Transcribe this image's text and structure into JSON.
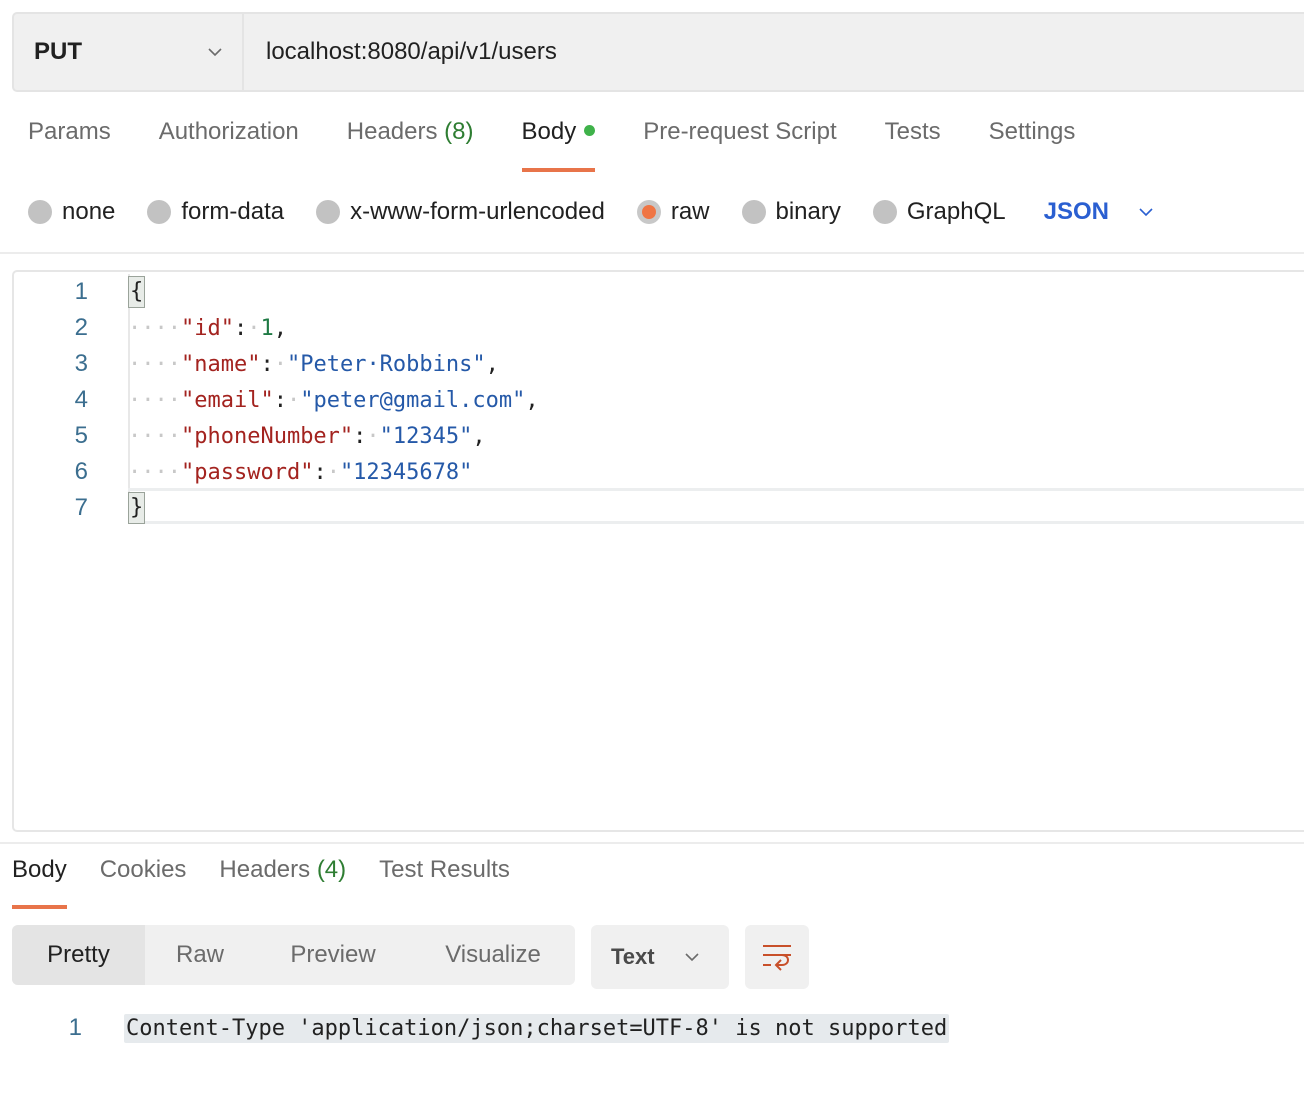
{
  "request": {
    "method": "PUT",
    "url": "localhost:8080/api/v1/users"
  },
  "request_tabs": [
    {
      "label": "Params",
      "count": null,
      "active": false
    },
    {
      "label": "Authorization",
      "count": null,
      "active": false
    },
    {
      "label": "Headers",
      "count": "(8)",
      "active": false
    },
    {
      "label": "Body",
      "count": null,
      "active": true,
      "indicator": "green-dot"
    },
    {
      "label": "Pre-request Script",
      "count": null,
      "active": false
    },
    {
      "label": "Tests",
      "count": null,
      "active": false
    },
    {
      "label": "Settings",
      "count": null,
      "active": false
    }
  ],
  "body_types": [
    {
      "label": "none",
      "checked": false
    },
    {
      "label": "form-data",
      "checked": false
    },
    {
      "label": "x-www-form-urlencoded",
      "checked": false
    },
    {
      "label": "raw",
      "checked": true
    },
    {
      "label": "binary",
      "checked": false
    },
    {
      "label": "GraphQL",
      "checked": false
    }
  ],
  "raw_language": "JSON",
  "editor": {
    "line_numbers": [
      "1",
      "2",
      "3",
      "4",
      "5",
      "6",
      "7"
    ],
    "lines": [
      {
        "open_brace": "{"
      },
      {
        "indent": "····",
        "key": "\"id\"",
        "colon": ":",
        "space": "·",
        "value": "1",
        "value_type": "number",
        "trail": ","
      },
      {
        "indent": "····",
        "key": "\"name\"",
        "colon": ":",
        "space": "·",
        "value": "\"Peter·Robbins\"",
        "value_type": "string",
        "trail": ","
      },
      {
        "indent": "····",
        "key": "\"email\"",
        "colon": ":",
        "space": "·",
        "value": "\"peter@gmail.com\"",
        "value_type": "string",
        "trail": ","
      },
      {
        "indent": "····",
        "key": "\"phoneNumber\"",
        "colon": ":",
        "space": "·",
        "value": "\"12345\"",
        "value_type": "string",
        "trail": ","
      },
      {
        "indent": "····",
        "key": "\"password\"",
        "colon": ":",
        "space": "·",
        "value": "\"12345678\"",
        "value_type": "string",
        "trail": ""
      },
      {
        "close_brace": "}"
      }
    ]
  },
  "response_tabs": [
    {
      "label": "Body",
      "count": null,
      "active": true
    },
    {
      "label": "Cookies",
      "count": null,
      "active": false
    },
    {
      "label": "Headers",
      "count": "(4)",
      "active": false
    },
    {
      "label": "Test Results",
      "count": null,
      "active": false
    }
  ],
  "response_views": [
    {
      "label": "Pretty",
      "active": true
    },
    {
      "label": "Raw",
      "active": false
    },
    {
      "label": "Preview",
      "active": false
    },
    {
      "label": "Visualize",
      "active": false
    }
  ],
  "response_format": "Text",
  "wrap_icon": "wrap-lines-icon",
  "response_body": {
    "line_number": "1",
    "text": "Content-Type 'application/json;charset=UTF-8' is not supported"
  },
  "colors": {
    "accent": "#e8744a",
    "count_green": "#2e7d32",
    "json_blue": "#2a5fd1",
    "key_red": "#a3231f",
    "string_blue": "#2559a8",
    "number_green": "#1f7a44"
  }
}
